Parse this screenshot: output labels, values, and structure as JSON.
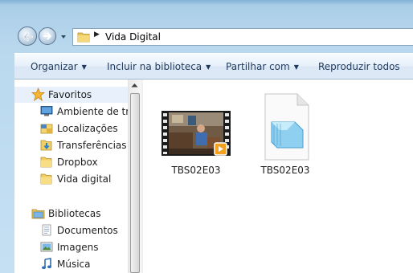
{
  "address": {
    "path": [
      "Vida Digital"
    ]
  },
  "toolbar": {
    "items": [
      {
        "label": "Organizar",
        "dropdown": true
      },
      {
        "label": "Incluir na biblioteca",
        "dropdown": true
      },
      {
        "label": "Partilhar com",
        "dropdown": true
      },
      {
        "label": "Reproduzir todos",
        "dropdown": false
      }
    ]
  },
  "nav": {
    "favorites": {
      "label": "Favoritos",
      "items": [
        "Ambiente de trab",
        "Localizações",
        "Transferências",
        "Dropbox",
        "Vida digital"
      ]
    },
    "libraries": {
      "label": "Bibliotecas",
      "items": [
        "Documentos",
        "Imagens",
        "Música"
      ]
    }
  },
  "files": [
    {
      "name": "TBS02E03",
      "type": "video"
    },
    {
      "name": "TBS02E03",
      "type": "text"
    }
  ],
  "icons": {
    "back": "arrow-left-icon",
    "forward": "arrow-right-icon",
    "history": "chevron-down-icon",
    "folder": "folder-icon",
    "favorites": "star-icon",
    "libraries": "library-icon"
  }
}
